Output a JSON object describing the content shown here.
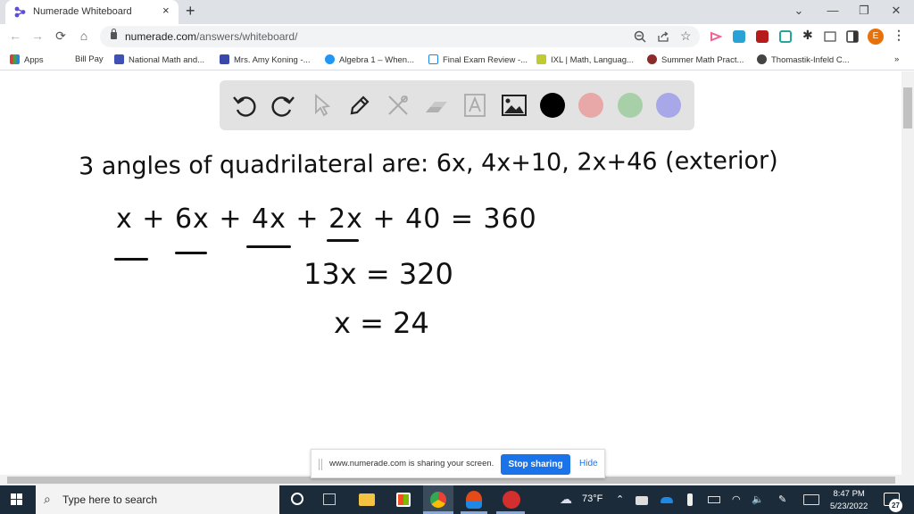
{
  "browser": {
    "tab": {
      "title": "Numerade Whiteboard",
      "close_icon": "×"
    },
    "new_tab_icon": "+",
    "window_controls": {
      "tab_search": "⌄",
      "minimize": "—",
      "restore": "❐",
      "close": "✕"
    },
    "nav": {
      "back": "←",
      "forward": "→",
      "reload": "⟳",
      "home": "⌂"
    },
    "address_bar": {
      "domain": "numerade.com",
      "path": "/answers/whiteboard/"
    },
    "omnibox_icons": [
      "zoom-out-icon",
      "share-icon",
      "bookmark-star-icon"
    ],
    "extensions": [
      {
        "name": "screencastify",
        "color": "#f06292"
      },
      {
        "name": "extension-blue",
        "color": "#1e88e5"
      },
      {
        "name": "adobe-acrobat",
        "color": "#b71c1c"
      },
      {
        "name": "extension-green",
        "color": "#26a69a"
      },
      {
        "name": "extensions-puzzle",
        "color": "#333333"
      },
      {
        "name": "cast",
        "color": "#555555"
      },
      {
        "name": "side-panel",
        "color": "#333333"
      }
    ],
    "profile_initial": "E",
    "bookmarks": [
      {
        "label": "Apps",
        "icon_color": "#e53935"
      },
      {
        "label": "Bill Pay",
        "icon_color": ""
      },
      {
        "label": "National Math and...",
        "icon_color": "#3f51b5"
      },
      {
        "label": "Mrs. Amy Koning -...",
        "icon_color": "#3949ab"
      },
      {
        "label": "Algebra 1 – When...",
        "icon_color": "#2196f3"
      },
      {
        "label": "Final Exam Review -...",
        "icon_color": "#1e88e5"
      },
      {
        "label": "IXL | Math, Languag...",
        "icon_color": "#c0ca33"
      },
      {
        "label": "Summer Math Pract...",
        "icon_color": "#8d2a2a"
      },
      {
        "label": "Thomastik-Infeld C...",
        "icon_color": "#444444"
      }
    ],
    "bookmarks_overflow": "»"
  },
  "whiteboard": {
    "tools": [
      {
        "name": "undo",
        "enabled": true
      },
      {
        "name": "redo",
        "enabled": true
      },
      {
        "name": "select",
        "enabled": false
      },
      {
        "name": "pen",
        "enabled": true
      },
      {
        "name": "tools",
        "enabled": false
      },
      {
        "name": "eraser",
        "enabled": false
      },
      {
        "name": "text",
        "enabled": false
      },
      {
        "name": "image",
        "enabled": true
      }
    ],
    "colors": [
      "#000000",
      "#e8a8a8",
      "#a8d0a8",
      "#a8a8e8"
    ],
    "handwriting": {
      "line1": "3 angles of quadrilateral are:  6x,  4x+10,  2x+46  (exterior)",
      "line2": "x + 6x + 4x + 2x + 40 = 360",
      "line3": "13x = 320",
      "line4": "x = 24"
    }
  },
  "share_bar": {
    "message": "www.numerade.com is sharing your screen.",
    "stop_label": "Stop sharing",
    "hide_label": "Hide"
  },
  "taskbar": {
    "search_placeholder": "Type here to search",
    "weather": "73°F",
    "time": "8:47 PM",
    "date": "5/23/2022",
    "notification_count": "27"
  }
}
